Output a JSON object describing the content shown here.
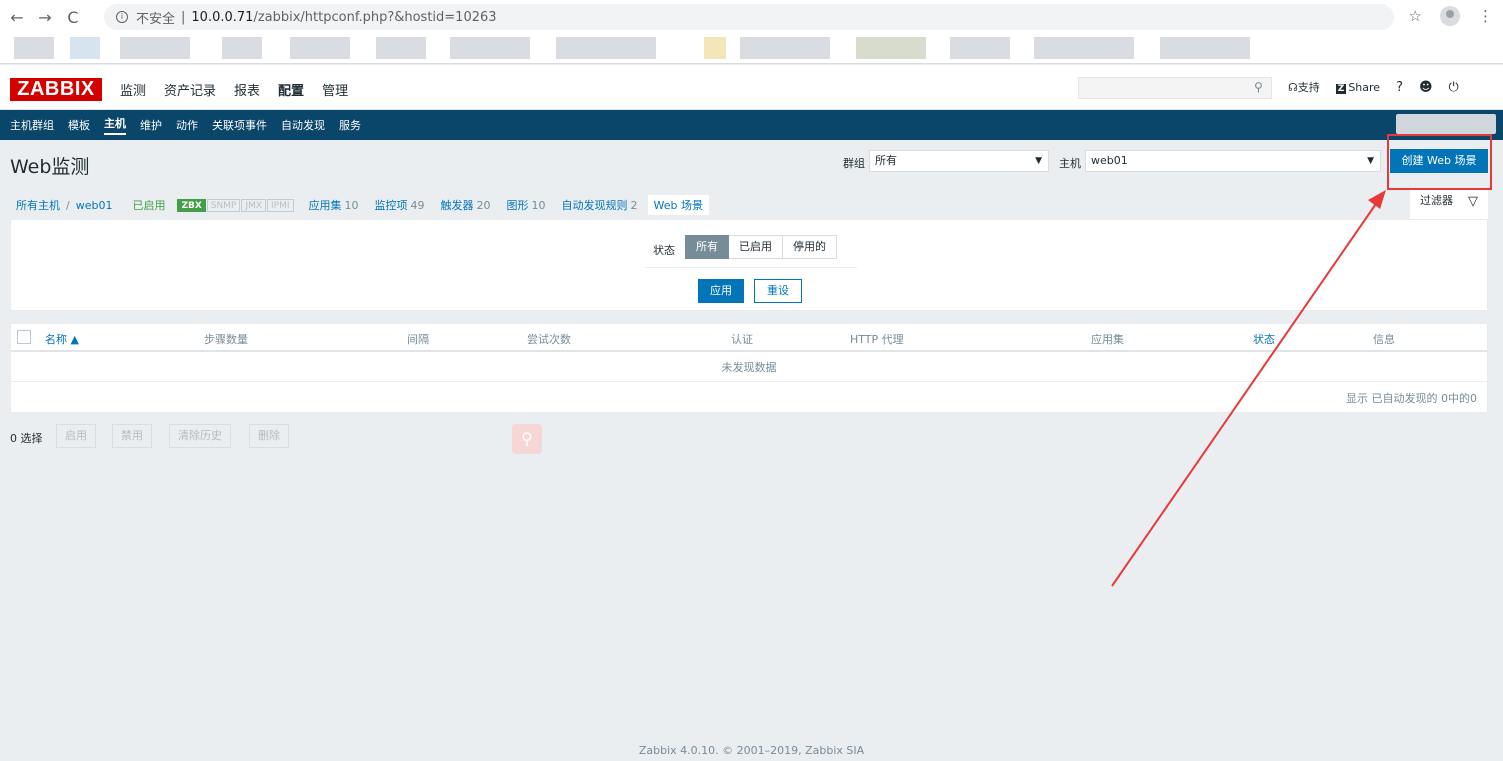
{
  "browser": {
    "back": "←",
    "forward": "→",
    "reload": "C",
    "security": "不安全",
    "url_host": "10.0.0.71",
    "url_path": "/zabbix/httpconf.php?&hostid=10263",
    "star": "☆",
    "menu": "⋮"
  },
  "header": {
    "logo": "ZABBIX",
    "menu": [
      "监测",
      "资产记录",
      "报表",
      "配置",
      "管理"
    ],
    "search_icon": "search-icon",
    "support": "支持",
    "share_badge": "Z",
    "share": "Share",
    "help": "?"
  },
  "subnav": {
    "items": [
      "主机群组",
      "模板",
      "主机",
      "维护",
      "动作",
      "关联项事件",
      "自动发现",
      "服务"
    ]
  },
  "page": {
    "title": "Web监测",
    "group_label": "群组",
    "group_value": "所有",
    "host_label": "主机",
    "host_value": "web01",
    "create_button": "创建 Web 场景"
  },
  "hostnav": {
    "all_hosts": "所有主机",
    "separator": "/",
    "host": "web01",
    "status": "已启用",
    "tags": [
      "ZBX",
      "SNMP",
      "JMX",
      "IPMI"
    ],
    "tabs": [
      {
        "label": "应用集",
        "count": "10"
      },
      {
        "label": "监控项",
        "count": "49"
      },
      {
        "label": "触发器",
        "count": "20"
      },
      {
        "label": "图形",
        "count": "10"
      },
      {
        "label": "自动发现规则",
        "count": "2"
      }
    ],
    "current": "Web 场景"
  },
  "filter": {
    "tab_label": "过滤器",
    "status_label": "状态",
    "options": [
      "所有",
      "已启用",
      "停用的"
    ],
    "apply": "应用",
    "reset": "重设"
  },
  "table": {
    "columns": [
      "名称 ▲",
      "步骤数量",
      "间隔",
      "尝试次数",
      "认证",
      "HTTP 代理",
      "应用集",
      "状态",
      "信息"
    ],
    "empty": "未发现数据",
    "paging": "显示 已自动发现的 0中的0"
  },
  "actions": {
    "selected": "0 选择",
    "buttons": [
      "启用",
      "禁用",
      "清除历史",
      "删除"
    ]
  },
  "footer": "Zabbix 4.0.10. © 2001–2019, Zabbix SIA",
  "colors": {
    "brand": "#d40000",
    "nav": "#0a466a",
    "primary": "#0275b8",
    "annotation": "#e63a3a",
    "enabled": "#429e47"
  }
}
